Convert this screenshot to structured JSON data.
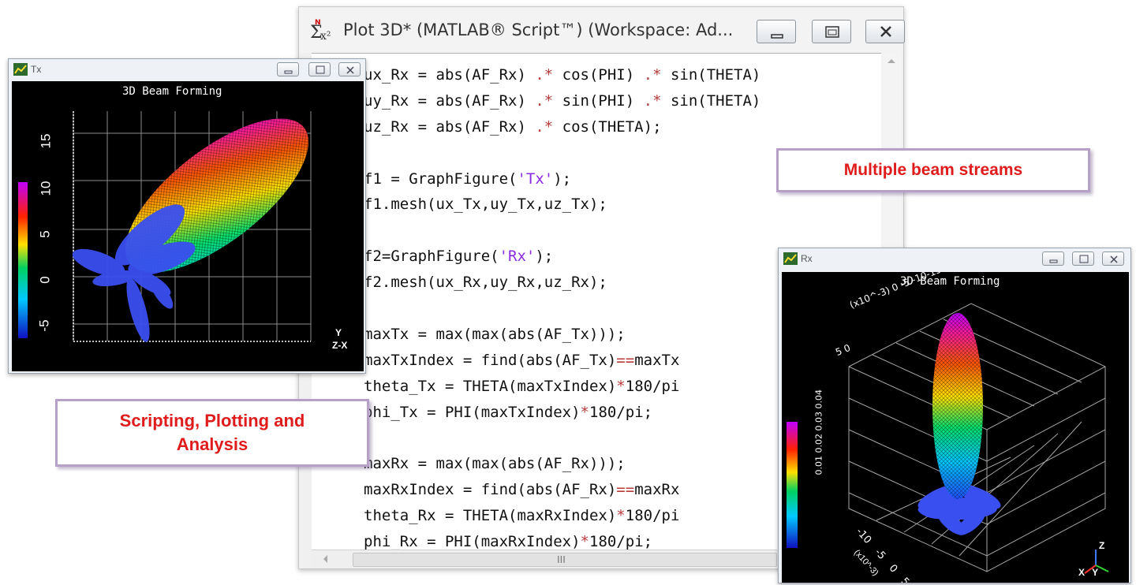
{
  "script_window": {
    "title": "Plot 3D* (MATLAB® Script™) (Workspace: Ad...",
    "app_icon": "sigma-x2-icon",
    "scroll_thumb_glyph": "III",
    "code_lines": [
      "ux_Rx = abs(AF_Rx) .* cos(PHI) .* sin(THETA)",
      "uy_Rx = abs(AF_Rx) .* sin(PHI) .* sin(THETA)",
      "uz_Rx = abs(AF_Rx) .* cos(THETA);",
      "",
      "f1 = GraphFigure('Tx');",
      "f1.mesh(ux_Tx,uy_Tx,uz_Tx);",
      "",
      "f2=GraphFigure('Rx');",
      "f2.mesh(ux_Rx,uy_Rx,uz_Rx);",
      "",
      "maxTx = max(max(abs(AF_Tx)));",
      "maxTxIndex = find(abs(AF_Tx)==maxTx",
      "theta_Tx = THETA(maxTxIndex)*180/pi",
      "phi_Tx = PHI(maxTxIndex)*180/pi;",
      "",
      "maxRx = max(max(abs(AF_Rx)));",
      "maxRxIndex = find(abs(AF_Rx)==maxRx",
      "theta_Rx = THETA(maxRxIndex)*180/pi",
      "phi_Rx = PHI(maxRxIndex)*180/pi;"
    ]
  },
  "tx_window": {
    "title": "Tx",
    "heading": "3D Beam Forming",
    "y_ticks": [
      "15",
      "10",
      "5",
      "0",
      "-5"
    ],
    "axis_y": "Y",
    "axis_zx": "Z-X"
  },
  "rx_window": {
    "title": "Rx",
    "heading": "3D Beam Forming",
    "top_axis": "(x10^-3) 0 -5 -10-15-20-25-30",
    "top_axis_left": "5 0",
    "side_axis": "0.01 0.02 0.03 0.04",
    "bottom_axis": "-10 -5 0 5",
    "bottom_unit": "(x10^-3)",
    "axis_z": "Z",
    "axis_xy": "X Y"
  },
  "callouts": {
    "multiple_beams": "Multiple beam streams",
    "scripting": "Scripting, Plotting and Analysis"
  },
  "colors": {
    "callout_text": "#e01b1b",
    "callout_border": "#b7a0c8",
    "plot_bg": "#000000"
  }
}
